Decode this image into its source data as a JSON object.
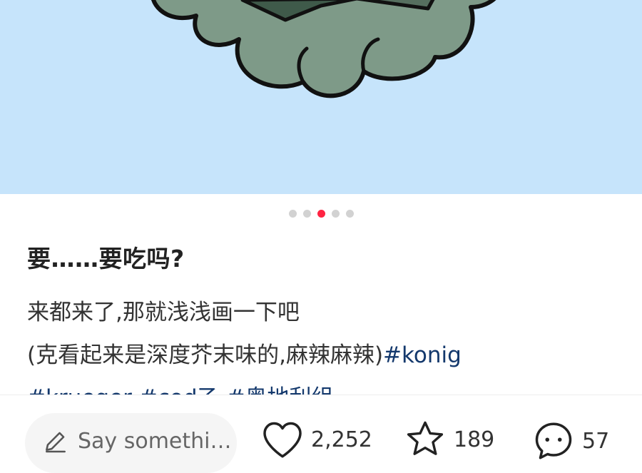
{
  "carousel": {
    "total": 5,
    "active_index": 2
  },
  "post": {
    "title": "要……要吃吗?",
    "description_line_1": "来都来了,那就浅浅画一下吧",
    "description_line_2": "(克看起来是深度芥末味的,麻辣麻辣)",
    "tags_line_2": [
      "#konig"
    ],
    "tags_line_3": [
      "#krueger",
      "#cod乙",
      "#奥地利组"
    ]
  },
  "footer": {
    "comment_placeholder": "Say somethi…",
    "likes": "2,252",
    "favorites": "189",
    "comments": "57"
  },
  "colors": {
    "hero_background": "#c6e4fb",
    "active_dot": "#ff2442",
    "hashtag": "#13386c"
  },
  "icons": [
    "pencil-icon",
    "heart-icon",
    "star-icon",
    "comment-bubble-icon"
  ]
}
